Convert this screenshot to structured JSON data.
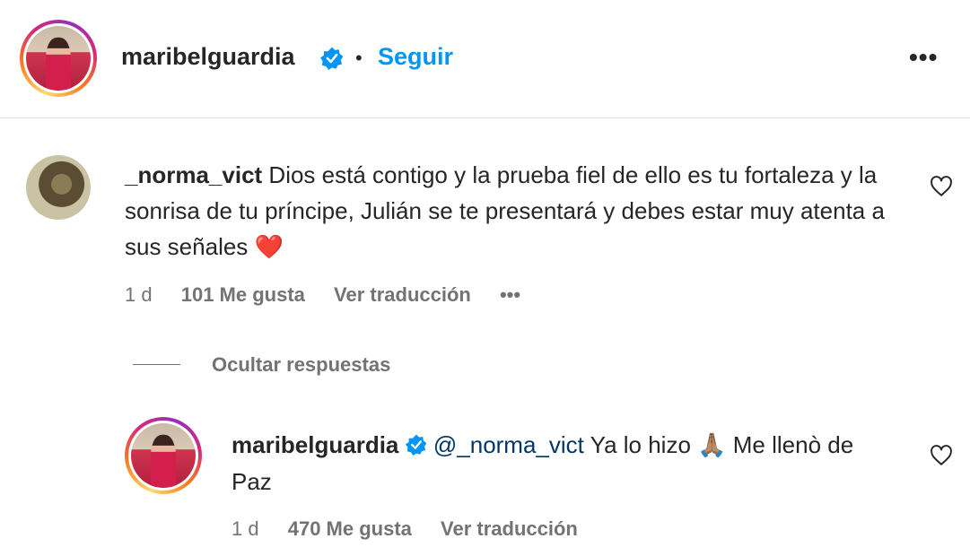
{
  "header": {
    "username": "maribelguardia",
    "separator": "•",
    "follow_label": "Seguir",
    "more_label": "•••"
  },
  "comment": {
    "username": "_norma_vict",
    "text": "Dios está contigo y la prueba fiel de ello es tu fortaleza y la sonrisa de tu príncipe, Julián se te presentará y debes estar muy atenta a sus señales",
    "emoji": "❤️",
    "time": "1 d",
    "likes": "101 Me gusta",
    "translate_label": "Ver traducción",
    "options_label": "•••"
  },
  "replies_toggle": {
    "label": "Ocultar respuestas"
  },
  "reply": {
    "username": "maribelguardia",
    "mention": "@_norma_vict",
    "text_before_emoji": "Ya lo hizo",
    "emoji": "🙏🏽",
    "text_after_emoji": "Me llenò de Paz",
    "time": "1 d",
    "likes": "470 Me gusta",
    "translate_label": "Ver traducción"
  },
  "colors": {
    "accent_blue": "#0095f6",
    "verified_blue": "#0095f6",
    "mention": "#00376b",
    "muted": "#737373",
    "heart_red": "#e0245e"
  }
}
